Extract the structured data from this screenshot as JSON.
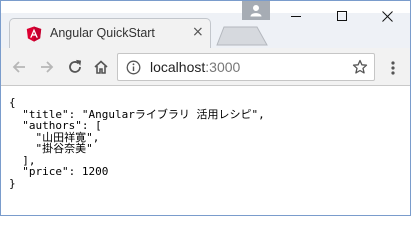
{
  "tab": {
    "title": "Angular QuickStart",
    "close_glyph": "×"
  },
  "address_bar": {
    "host": "localhost",
    "port": ":3000"
  },
  "icons": {
    "favicon": "angular-logo-icon",
    "profile": "person-icon",
    "minimize": "minimize-icon",
    "maximize": "maximize-icon",
    "close": "close-icon",
    "back": "arrow-left-icon",
    "forward": "arrow-right-icon",
    "reload": "reload-icon",
    "home": "home-icon",
    "info": "info-icon",
    "bookmark": "star-icon",
    "menu": "kebab-menu-icon"
  },
  "colors": {
    "angular_red": "#dd0031",
    "chrome_toolbar": "#f2f2f2",
    "window_border": "#7a9ccc"
  },
  "page": {
    "json_lines": [
      "{",
      "  \"title\": \"Angularライブラリ 活用レシピ\",",
      "  \"authors\": [",
      "    \"山田祥寛\",",
      "    \"掛谷奈美\"",
      "  ],",
      "  \"price\": 1200",
      "}"
    ]
  }
}
